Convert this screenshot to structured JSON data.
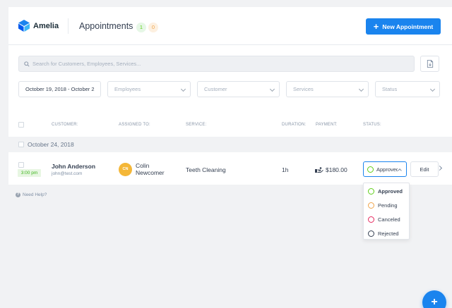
{
  "app": {
    "name": "Amelia"
  },
  "header": {
    "title": "Appointments",
    "approved_count": "1",
    "pending_count": "0",
    "new_button_label": "New Appointment"
  },
  "search": {
    "placeholder": "Search for Customers, Employees, Services..."
  },
  "filters": {
    "date_range": "October 19, 2018 - October 2",
    "employees": "Employees",
    "customer": "Customer",
    "services": "Services",
    "status": "Status"
  },
  "table": {
    "headers": {
      "customer": "CUSTOMER:",
      "assigned_to": "ASSIGNED TO:",
      "service": "SERVICE:",
      "duration": "DURATION:",
      "payment": "PAYMENT:",
      "status": "STATUS:"
    },
    "group_date": "October 24, 2018",
    "row": {
      "time": "3:00 pm",
      "customer_name": "John Anderson",
      "customer_email": "john@test.com",
      "employee_initials": "CN",
      "employee_first": "Colin",
      "employee_last": "Newcomer",
      "service": "Teeth Cleaning",
      "duration": "1h",
      "payment": "$180.00",
      "status_value": "Approved",
      "edit_label": "Edit"
    }
  },
  "status_options": [
    {
      "label": "Approved",
      "color": "#5fce19"
    },
    {
      "label": "Pending",
      "color": "#f0a54b"
    },
    {
      "label": "Canceled",
      "color": "#e6295f"
    },
    {
      "label": "Rejected",
      "color": "#354052"
    }
  ],
  "footer": {
    "help_label": "Need Help?"
  },
  "fab": {
    "label": "+"
  },
  "colors": {
    "accent": "#1a84ee",
    "approved": "#5fce19",
    "pending": "#f0a54b"
  }
}
